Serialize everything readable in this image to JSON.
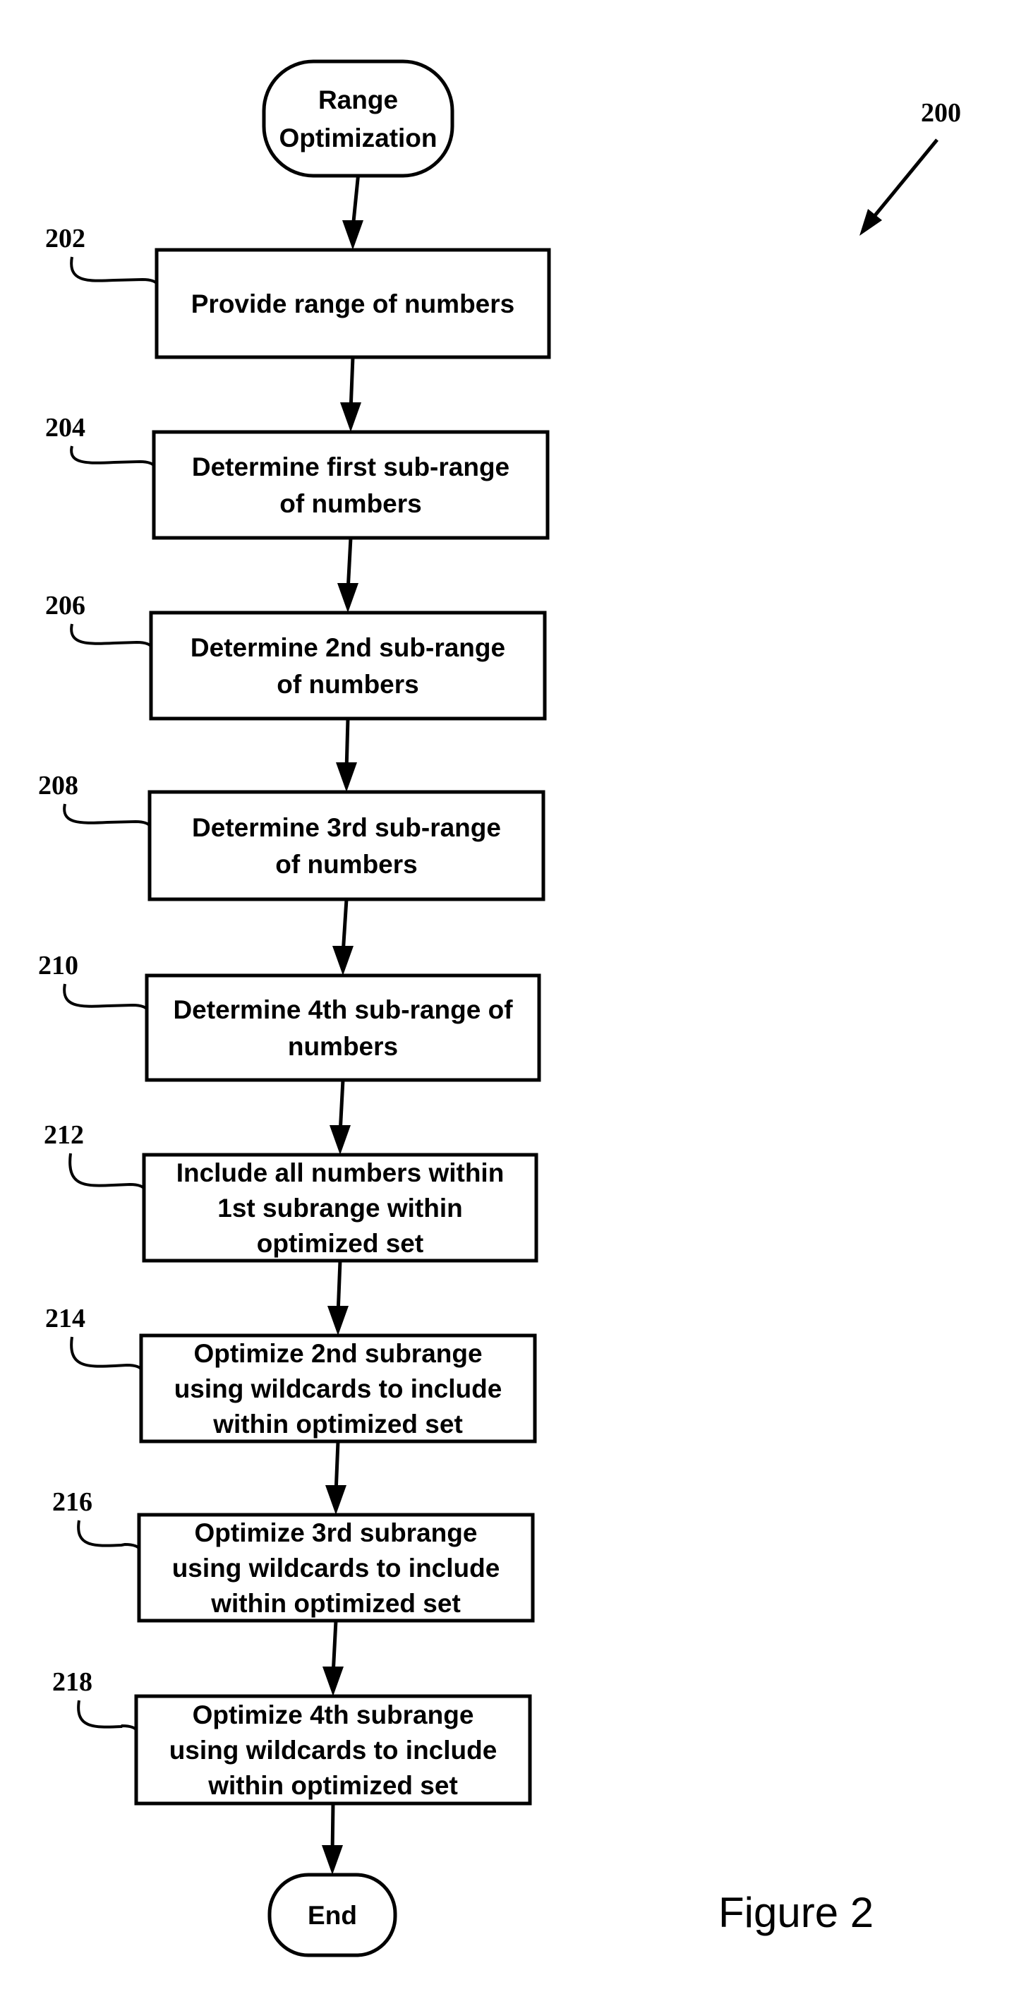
{
  "figure": {
    "number_label": "200",
    "caption": "Figure 2"
  },
  "start": {
    "label_lines": [
      "Range",
      "Optimization"
    ]
  },
  "end": {
    "label_lines": [
      "End"
    ]
  },
  "steps": [
    {
      "ref": "202",
      "lines": [
        "Provide range of numbers"
      ]
    },
    {
      "ref": "204",
      "lines": [
        "Determine first sub-range",
        "of numbers"
      ]
    },
    {
      "ref": "206",
      "lines": [
        "Determine 2nd sub-range",
        "of numbers"
      ]
    },
    {
      "ref": "208",
      "lines": [
        "Determine 3rd sub-range",
        "of numbers"
      ]
    },
    {
      "ref": "210",
      "lines": [
        "Determine 4th sub-range of",
        "numbers"
      ]
    },
    {
      "ref": "212",
      "lines": [
        "Include all numbers within",
        "1st subrange within",
        "optimized set"
      ]
    },
    {
      "ref": "214",
      "lines": [
        "Optimize 2nd subrange",
        "using wildcards to include",
        "within optimized set"
      ]
    },
    {
      "ref": "216",
      "lines": [
        "Optimize 3rd subrange",
        "using wildcards to include",
        "within optimized set"
      ]
    },
    {
      "ref": "218",
      "lines": [
        "Optimize 4th subrange",
        "using wildcards to include",
        "within optimized set"
      ]
    }
  ]
}
